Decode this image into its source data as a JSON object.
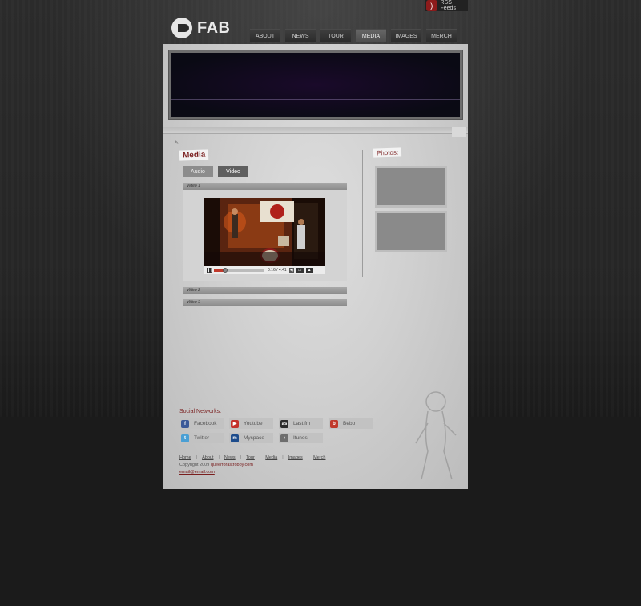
{
  "header": {
    "logo_text": "FAB",
    "rss_label": "RSS Feeds",
    "nav": [
      "ABOUT",
      "NEWS",
      "TOUR",
      "MEDIA",
      "IMAGES",
      "MERCH"
    ],
    "active_nav": "MEDIA"
  },
  "media": {
    "title": "Media",
    "tabs": [
      "Audio",
      "Video"
    ],
    "active_tab": "Video",
    "videos": [
      "Video 1",
      "Video 2",
      "Video 3"
    ],
    "player": {
      "time": "0:16 / 4:41",
      "progress_percent": 22
    }
  },
  "photos": {
    "title": "Photos:"
  },
  "social": {
    "title": "Social Networks:",
    "items": [
      {
        "label": "Facebook",
        "icon": "facebook-icon",
        "glyph": "f",
        "color": "#3b5998"
      },
      {
        "label": "Youtube",
        "icon": "youtube-icon",
        "glyph": "▶",
        "color": "#c4302b"
      },
      {
        "label": "Last.fm",
        "icon": "lastfm-icon",
        "glyph": "as",
        "color": "#2b2b2b"
      },
      {
        "label": "Bebo",
        "icon": "bebo-icon",
        "glyph": "b",
        "color": "#c0392b"
      },
      {
        "label": "Twitter",
        "icon": "twitter-icon",
        "glyph": "t",
        "color": "#4a9fd4"
      },
      {
        "label": "Myspace",
        "icon": "myspace-icon",
        "glyph": "m",
        "color": "#1d4c8c"
      },
      {
        "label": "Itunes",
        "icon": "itunes-icon",
        "glyph": "♪",
        "color": "#6d6d6d"
      }
    ]
  },
  "footer": {
    "links": [
      "Home",
      "About",
      "News",
      "Tour",
      "Media",
      "Images",
      "Merch"
    ],
    "copyright_prefix": "Copyright 2009",
    "copyright_link": "queerforastroboy.com",
    "email": "email@email.com"
  }
}
